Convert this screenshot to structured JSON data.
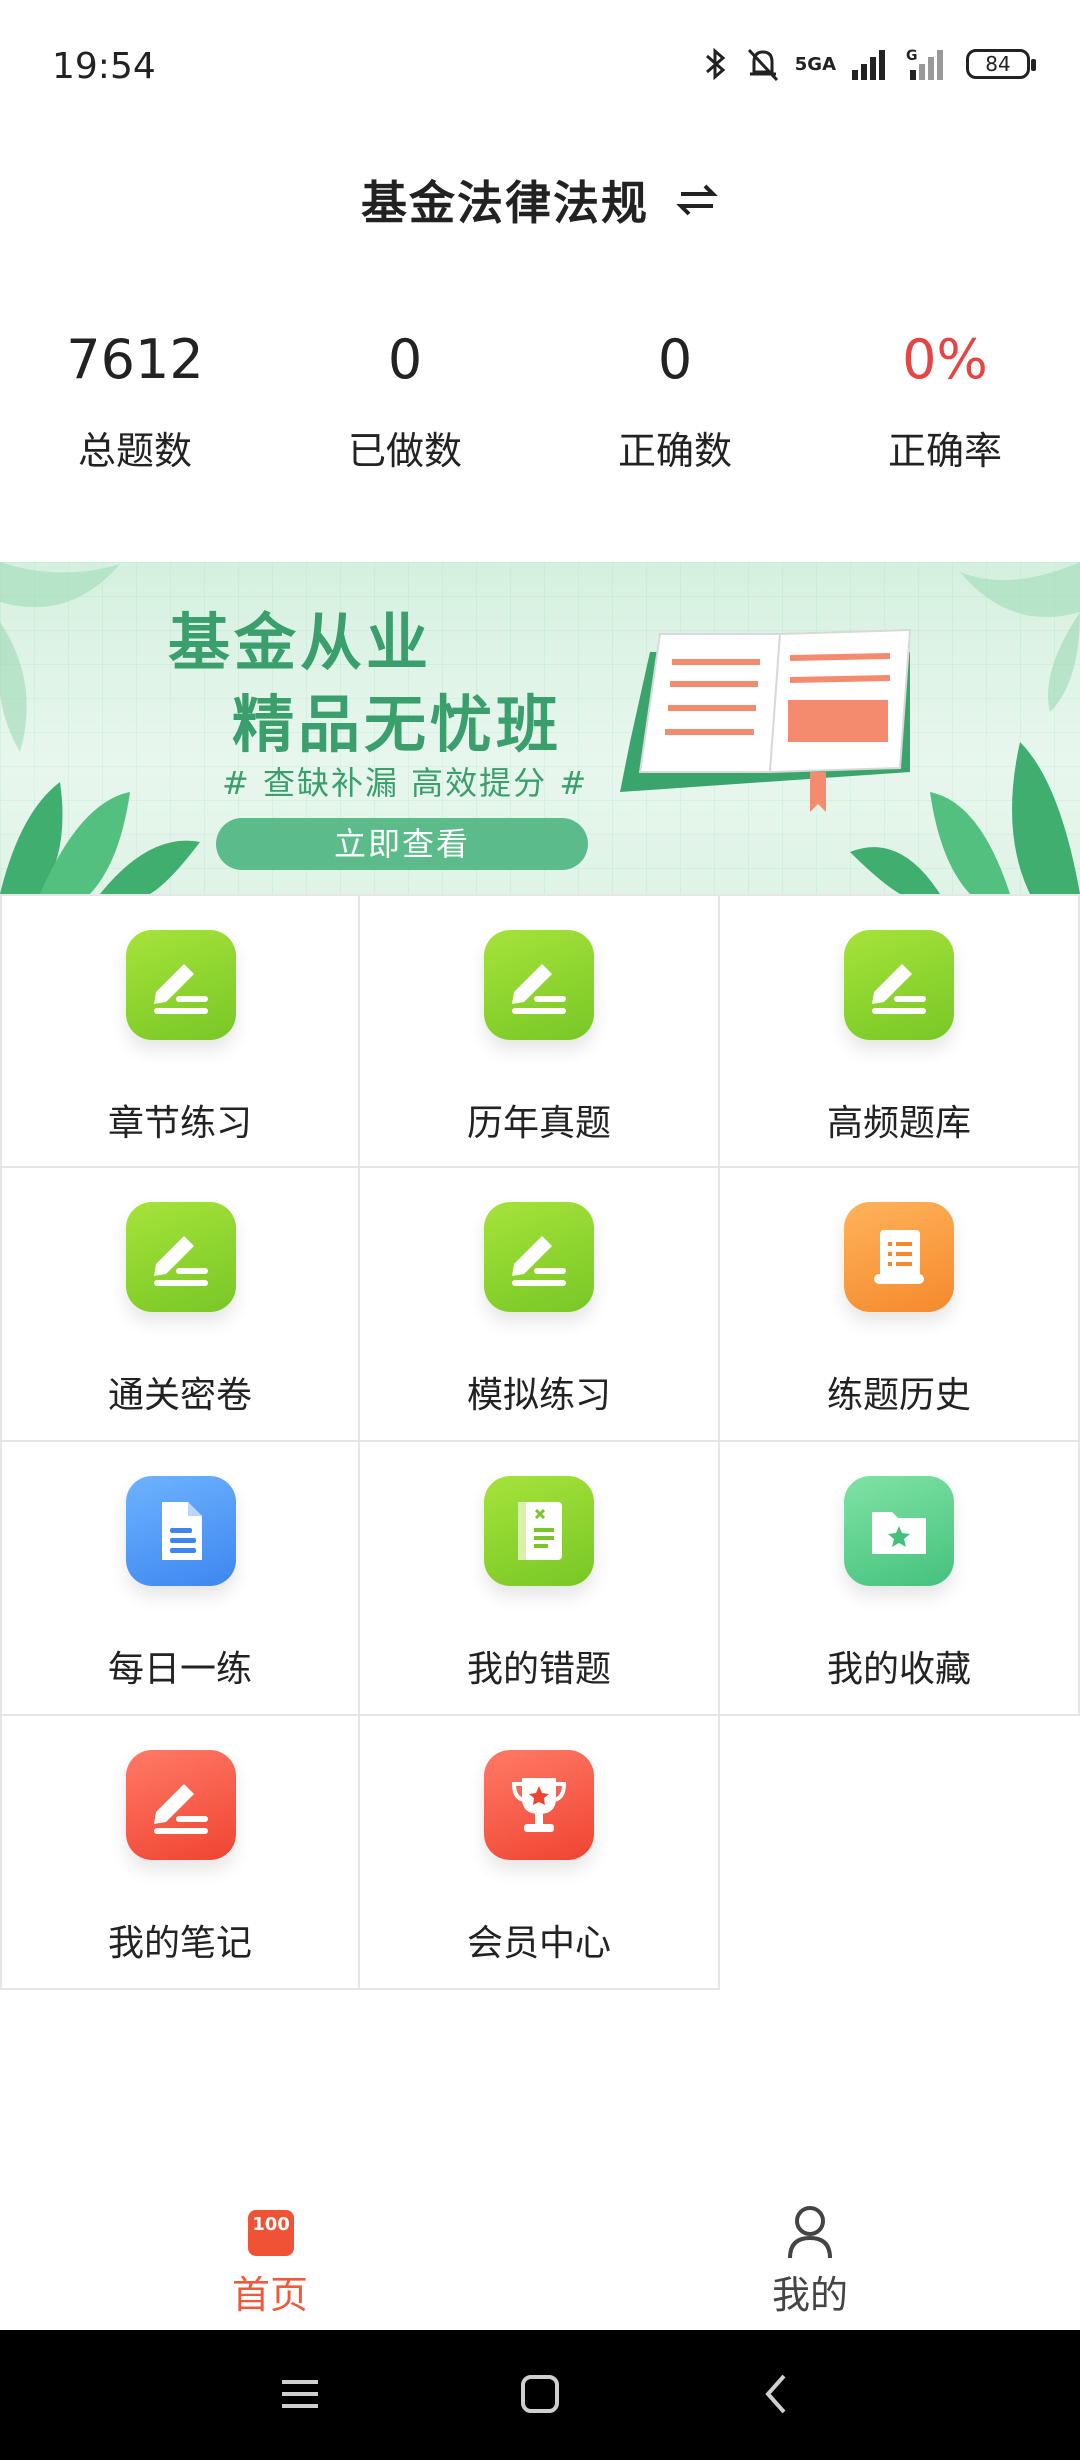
{
  "status_bar": {
    "time": "19:54",
    "network": "5GA",
    "battery": "84"
  },
  "header": {
    "title": "基金法律法规"
  },
  "stats": [
    {
      "value": "7612",
      "label": "总题数"
    },
    {
      "value": "0",
      "label": "已做数"
    },
    {
      "value": "0",
      "label": "正确数"
    },
    {
      "value": "0%",
      "label": "正确率"
    }
  ],
  "banner": {
    "line1": "基金从业",
    "line2": "精品无忧班",
    "subtitle": "# 查缺补漏 高效提分 #",
    "button": "立即查看"
  },
  "grid": [
    {
      "label": "章节练习",
      "icon": "pencil-icon",
      "color": "#8ed32f"
    },
    {
      "label": "历年真题",
      "icon": "pencil-icon",
      "color": "#8ed32f"
    },
    {
      "label": "高频题库",
      "icon": "pencil-icon",
      "color": "#8ed32f"
    },
    {
      "label": "通关密卷",
      "icon": "pencil-icon",
      "color": "#8ed32f"
    },
    {
      "label": "模拟练习",
      "icon": "pencil-icon",
      "color": "#8ed32f"
    },
    {
      "label": "练题历史",
      "icon": "scroll-icon",
      "color": "#f89a3c"
    },
    {
      "label": "每日一练",
      "icon": "document-icon",
      "color": "#4d95f5"
    },
    {
      "label": "我的错题",
      "icon": "notebook-icon",
      "color": "#8ed32f"
    },
    {
      "label": "我的收藏",
      "icon": "star-folder-icon",
      "color": "#58cf8c"
    },
    {
      "label": "我的笔记",
      "icon": "pencil-icon",
      "color": "#f45843"
    },
    {
      "label": "会员中心",
      "icon": "trophy-icon",
      "color": "#f45843"
    }
  ],
  "bottom_nav": {
    "home": {
      "label": "首页",
      "badge": "100",
      "color": "#ee5a3a"
    },
    "mine": {
      "label": "我的"
    }
  }
}
